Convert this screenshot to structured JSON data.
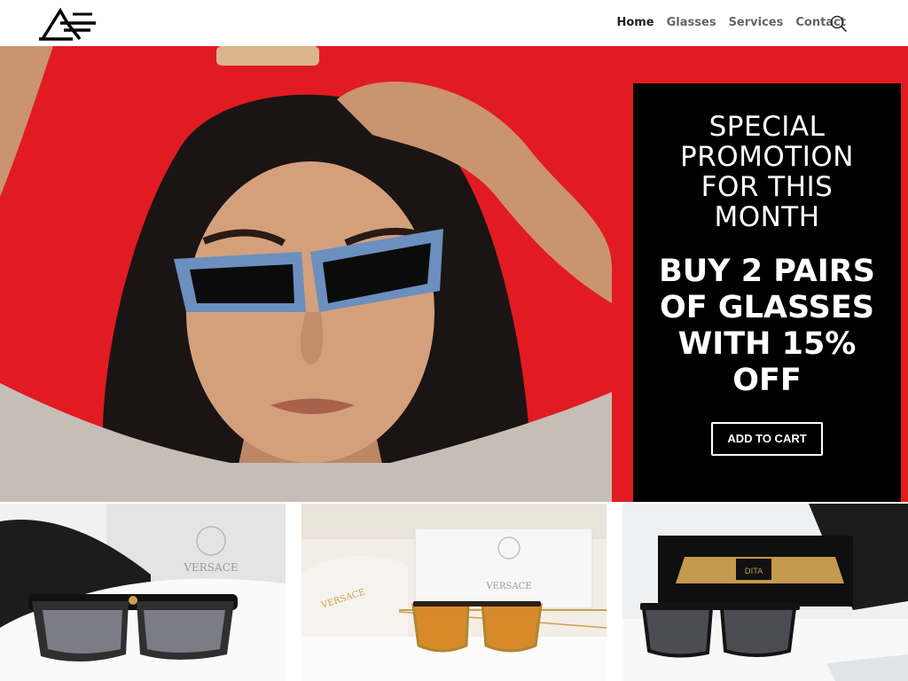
{
  "nav": {
    "items": [
      {
        "label": "Home",
        "active": true
      },
      {
        "label": "Glasses",
        "active": false
      },
      {
        "label": "Services",
        "active": false
      },
      {
        "label": "Contact",
        "active": false
      }
    ],
    "search_icon": "search-icon"
  },
  "promo": {
    "subtitle": "SPECIAL PROMOTION FOR THIS MONTH",
    "headline": "BUY 2 PAIRS OF GLASSES WITH 15% OFF",
    "button": "ADD TO CART"
  },
  "products": {
    "p1_brand": "VERSACE",
    "p2_case_brand": "VERSACE",
    "p2_box_brand": "VERSACE",
    "p3_brand": "DITA"
  },
  "colors": {
    "hero_bg": "#e21b22",
    "promo_bg": "#000000",
    "nav_active": "#222222",
    "nav_inactive": "#666666"
  }
}
